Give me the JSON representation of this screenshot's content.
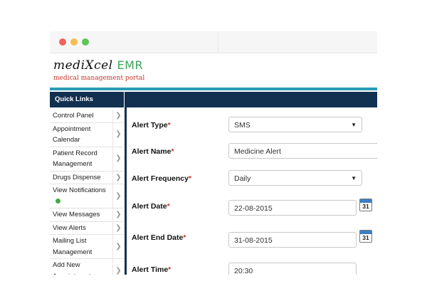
{
  "app": {
    "logo_main": "mediXcel",
    "logo_emr": "EMR",
    "logo_sub": "medical management portal"
  },
  "sidebar": {
    "header": "Quick Links",
    "items": [
      {
        "label": "Control Panel",
        "icon": "chevron-right-icon"
      },
      {
        "label": "Appointment Calendar",
        "icon": "chevron-right-icon"
      },
      {
        "label": "Patient Record Management",
        "icon": "chevron-right-icon"
      },
      {
        "label": "Drugs Dispense",
        "icon": "chevron-right-icon"
      },
      {
        "label": "View Notifications",
        "icon": "chevron-right-icon",
        "badge_icon": "bell-icon"
      },
      {
        "label": "View Messages",
        "icon": "chevron-right-icon"
      },
      {
        "label": "View Alerts",
        "icon": "chevron-right-icon"
      },
      {
        "label": "Mailing List Management",
        "icon": "chevron-right-icon"
      },
      {
        "label": "Add New Appointment",
        "icon": "chevron-right-icon"
      }
    ]
  },
  "form": {
    "required_mark": "*",
    "alert_type": {
      "label": "Alert Type",
      "value": "SMS"
    },
    "alert_name": {
      "label": "Alert Name",
      "value": "Medicine Alert"
    },
    "alert_frequency": {
      "label": "Alert Frequency",
      "value": "Daily"
    },
    "alert_date": {
      "label": "Alert Date",
      "value": "22-08-2015",
      "calendar_day": "31"
    },
    "alert_end_date": {
      "label": "Alert End Date",
      "value": "31-08-2015",
      "calendar_day": "31"
    },
    "alert_time": {
      "label": "Alert Time",
      "value": "20:30"
    }
  },
  "colors": {
    "nav_dark": "#12304f",
    "accent_line": "#2a9bb8",
    "required": "#c2362c",
    "logo_emr": "#3aa655"
  }
}
